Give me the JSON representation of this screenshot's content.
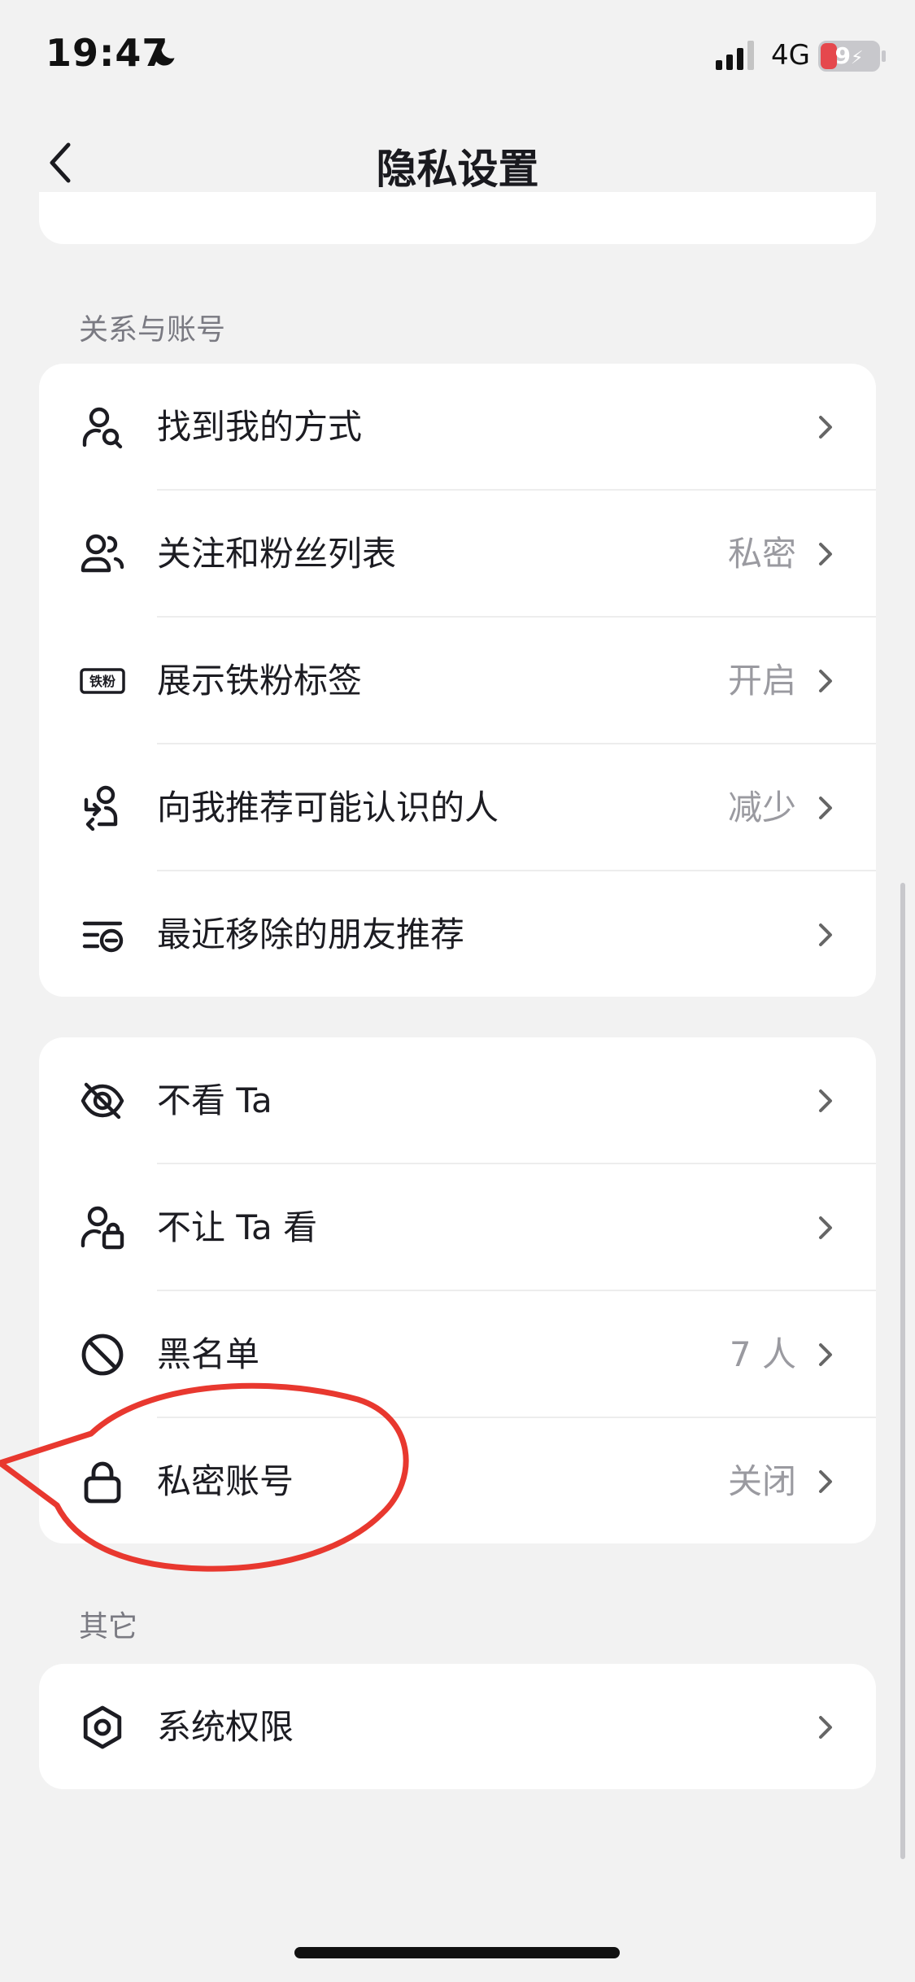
{
  "status_bar": {
    "time": "19:47",
    "network": "4G",
    "battery": "9"
  },
  "header": {
    "title": "隐私设置"
  },
  "sections": {
    "relations": {
      "label": "关系与账号",
      "items": [
        {
          "label": "找到我的方式",
          "value": "",
          "icon": "user-search-icon"
        },
        {
          "label": "关注和粉丝列表",
          "value": "私密",
          "icon": "users-icon"
        },
        {
          "label": "展示铁粉标签",
          "value": "开启",
          "icon": "fan-badge-icon"
        },
        {
          "label": "向我推荐可能认识的人",
          "value": "减少",
          "icon": "user-recommend-icon"
        },
        {
          "label": "最近移除的朋友推荐",
          "value": "",
          "icon": "list-remove-icon"
        }
      ]
    },
    "social": {
      "items": [
        {
          "label": "不看 Ta",
          "value": "",
          "icon": "eye-off-icon"
        },
        {
          "label": "不让 Ta 看",
          "value": "",
          "icon": "user-lock-icon"
        },
        {
          "label": "黑名单",
          "value": "7 人",
          "icon": "block-icon"
        },
        {
          "label": "私密账号",
          "value": "关闭",
          "icon": "lock-icon"
        }
      ]
    },
    "other": {
      "label": "其它",
      "items": [
        {
          "label": "系统权限",
          "value": "",
          "icon": "hexagon-settings-icon"
        }
      ]
    }
  },
  "badge_text": "铁粉",
  "colors": {
    "background": "#f2f2f2",
    "card": "#ffffff",
    "annotation": "#e8382f",
    "battery": "#e5484d"
  }
}
